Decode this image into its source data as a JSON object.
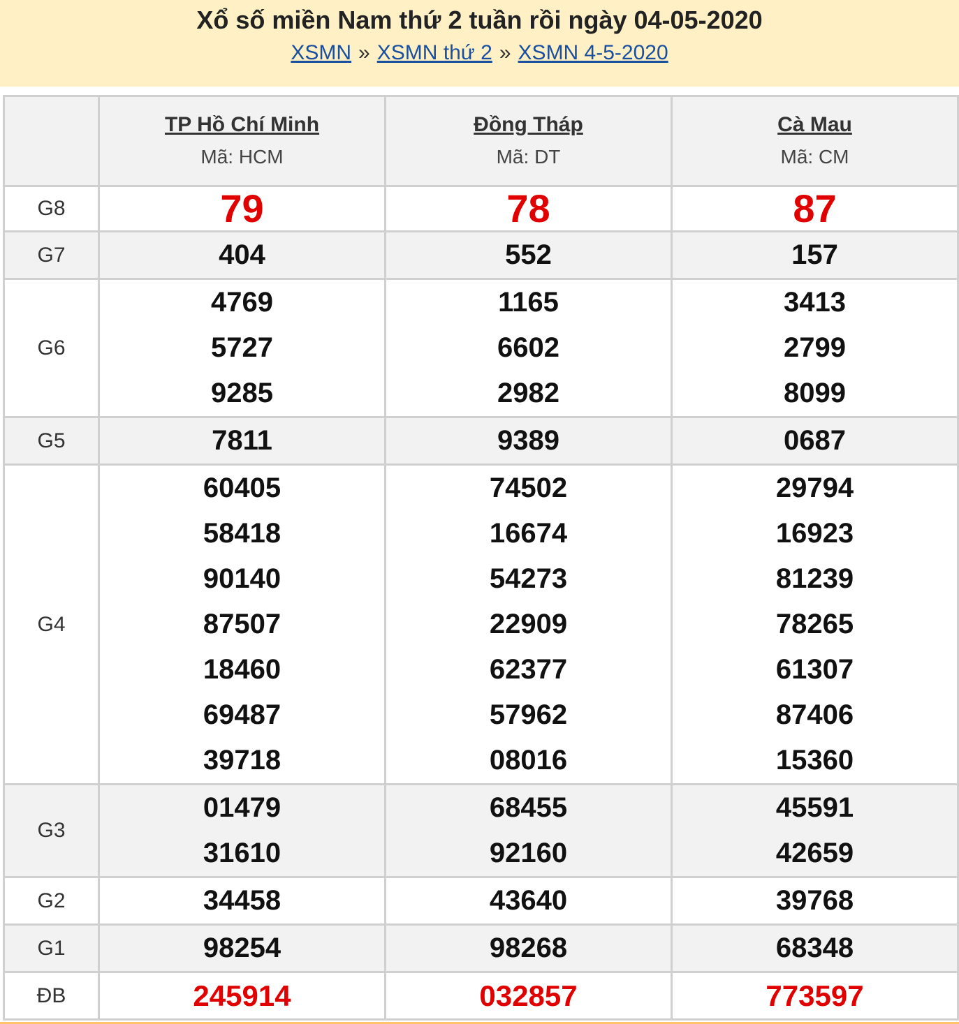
{
  "header": {
    "title": "Xổ số miền Nam thứ 2 tuần rồi ngày 04-05-2020",
    "breadcrumb": [
      "XSMN",
      "XSMN thứ 2",
      "XSMN 4-5-2020"
    ],
    "separator": "»"
  },
  "colors": {
    "header_bg": "#fff1c5",
    "link": "#1a4fa0",
    "highlight_red": "#e00000",
    "alt_row_bg": "#f2f2f2"
  },
  "provinces": [
    {
      "name": "TP Hồ Chí Minh",
      "code": "Mã: HCM"
    },
    {
      "name": "Đồng Tháp",
      "code": "Mã: DT"
    },
    {
      "name": "Cà Mau",
      "code": "Mã: CM"
    }
  ],
  "prizes": {
    "g8": {
      "label": "G8",
      "values": [
        [
          "79"
        ],
        [
          "78"
        ],
        [
          "87"
        ]
      ]
    },
    "g7": {
      "label": "G7",
      "values": [
        [
          "404"
        ],
        [
          "552"
        ],
        [
          "157"
        ]
      ]
    },
    "g6": {
      "label": "G6",
      "values": [
        [
          "4769",
          "5727",
          "9285"
        ],
        [
          "1165",
          "6602",
          "2982"
        ],
        [
          "3413",
          "2799",
          "8099"
        ]
      ]
    },
    "g5": {
      "label": "G5",
      "values": [
        [
          "7811"
        ],
        [
          "9389"
        ],
        [
          "0687"
        ]
      ]
    },
    "g4": {
      "label": "G4",
      "values": [
        [
          "60405",
          "58418",
          "90140",
          "87507",
          "18460",
          "69487",
          "39718"
        ],
        [
          "74502",
          "16674",
          "54273",
          "22909",
          "62377",
          "57962",
          "08016"
        ],
        [
          "29794",
          "16923",
          "81239",
          "78265",
          "61307",
          "87406",
          "15360"
        ]
      ]
    },
    "g3": {
      "label": "G3",
      "values": [
        [
          "01479",
          "31610"
        ],
        [
          "68455",
          "92160"
        ],
        [
          "45591",
          "42659"
        ]
      ]
    },
    "g2": {
      "label": "G2",
      "values": [
        [
          "34458"
        ],
        [
          "43640"
        ],
        [
          "39768"
        ]
      ]
    },
    "g1": {
      "label": "G1",
      "values": [
        [
          "98254"
        ],
        [
          "98268"
        ],
        [
          "68348"
        ]
      ]
    },
    "db": {
      "label": "ĐB",
      "values": [
        [
          "245914"
        ],
        [
          "032857"
        ],
        [
          "773597"
        ]
      ]
    }
  }
}
